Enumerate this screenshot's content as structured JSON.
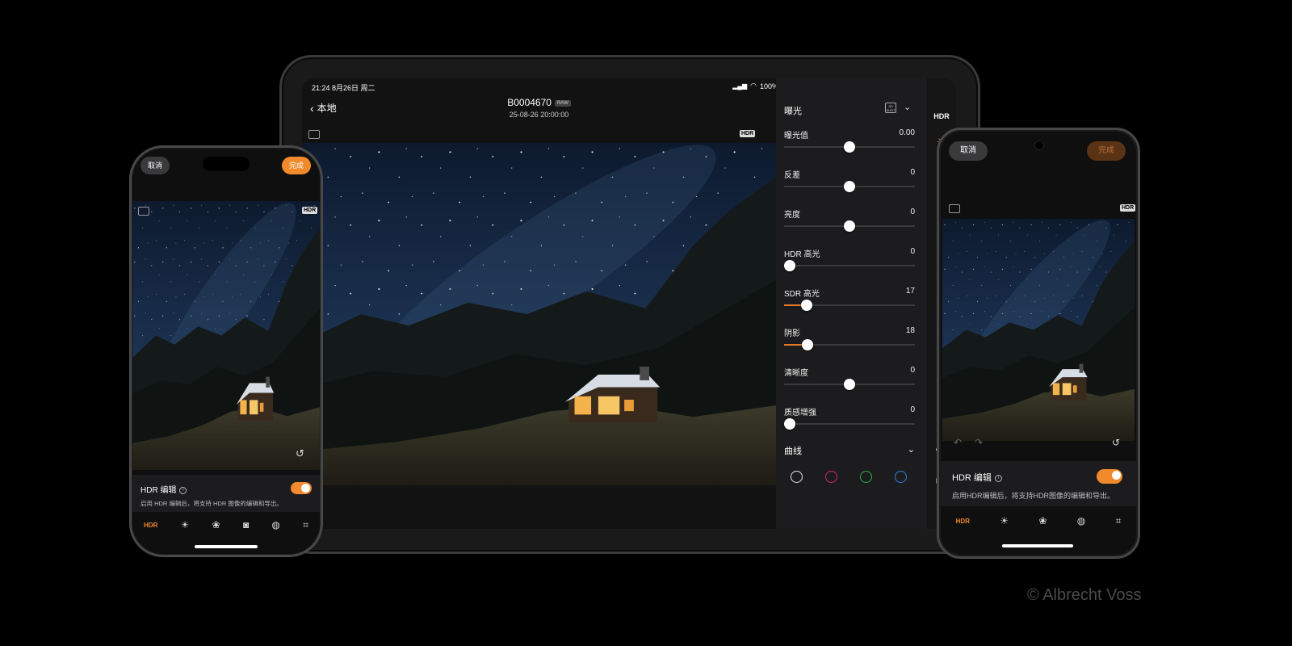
{
  "tablet": {
    "status": {
      "time_date": "21:24  8月26日  周二",
      "battery": "100%"
    },
    "back_label": "本地",
    "file_name": "B0004670",
    "raw_badge": "RAW",
    "date": "25-08-26 20:00:00",
    "hdr_badge": "HDR",
    "panel": {
      "section_title": "曝光",
      "as_shot_icon": "AS SHOT",
      "sliders": [
        {
          "label": "曝光值",
          "value": "0.00",
          "level": 0.5
        },
        {
          "label": "反差",
          "value": "0",
          "level": 0.5
        },
        {
          "label": "亮度",
          "value": "0",
          "level": 0.5
        },
        {
          "label": "HDR 高光",
          "value": "0",
          "level": 0.0
        },
        {
          "label": "SDR 高光",
          "value": "17",
          "level": 0.17
        },
        {
          "label": "阴影",
          "value": "18",
          "level": 0.18
        },
        {
          "label": "清晰度",
          "value": "0",
          "level": 0.5
        },
        {
          "label": "质感增强",
          "value": "0",
          "level": 0.0
        }
      ],
      "curve_title": "曲线",
      "curve_channels": [
        "#e6e6e6",
        "#e0245e",
        "#2ab04a",
        "#2f7fe0"
      ]
    },
    "rail": {
      "hdr_label": "HDR",
      "icons": [
        "sun-icon",
        "color-mix-icon",
        "camera-frame-icon",
        "lens-icon",
        "crop-icon",
        "presets-icon",
        "redo-icon",
        "undo-icon",
        "reset-icon",
        "share-icon",
        "heart-icon",
        "trash-icon",
        "info-icon"
      ]
    }
  },
  "phone_left": {
    "cancel_label": "取消",
    "done_label": "完成",
    "hdr_badge": "HDR",
    "hdr_title": "HDR 编辑",
    "hdr_desc": "启用 HDR 编辑后，将支持 HDR 图像的编辑和导出。",
    "tab_hdr": "HDR"
  },
  "phone_right": {
    "cancel_label": "取消",
    "done_label": "完成",
    "hdr_badge": "HDR",
    "hdr_title": "HDR 编辑",
    "hdr_desc": "启用HDR编辑后，将支持HDR图像的编辑和导出。",
    "tab_hdr": "HDR"
  },
  "colors": {
    "accent": "#f08a2c",
    "panel": "#1c1c1e",
    "background": "#000000"
  },
  "watermark": "© Albrecht Voss"
}
